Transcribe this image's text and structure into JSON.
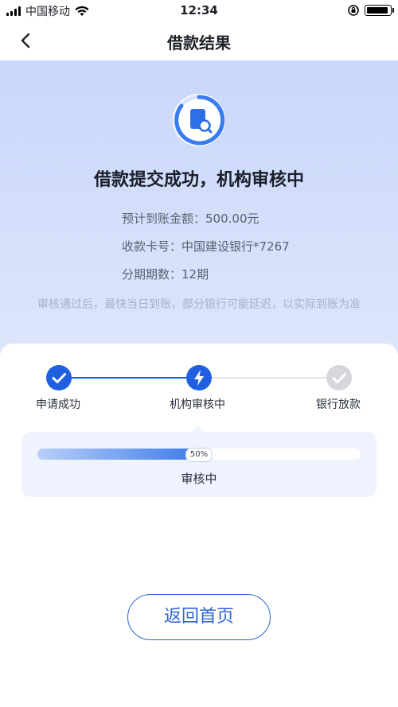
{
  "status_bar": {
    "carrier": "中国移动",
    "time": "12:34"
  },
  "nav": {
    "title": "借款结果"
  },
  "result": {
    "title": "借款提交成功，机构审核中",
    "expected_amount": "预计到账金额：500.00元",
    "card_number": "收款卡号：中国建设银行*7267",
    "installments": "分期期数：12期",
    "notice": "审核通过后，最快当日到账，部分银行可能延迟，以实际到账为准"
  },
  "steps": [
    {
      "label": "申请成功",
      "state": "done",
      "icon": "check-icon"
    },
    {
      "label": "机构审核中",
      "state": "active",
      "icon": "lightning-icon"
    },
    {
      "label": "银行放款",
      "state": "pending",
      "icon": "check-icon"
    }
  ],
  "progress": {
    "value": 50,
    "label": "50%",
    "status": "审核中"
  },
  "actions": {
    "home_label": "返回首页"
  },
  "colors": {
    "primary": "#1f5fe0",
    "hero_bg": "#c9d7fa",
    "pending": "#d5d7dc"
  }
}
